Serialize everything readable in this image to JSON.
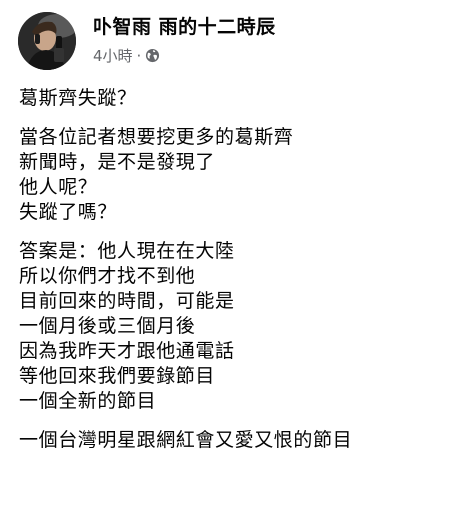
{
  "post": {
    "author": "卟智雨 雨的十二時辰",
    "timestamp": "4小時",
    "separator": "·",
    "privacy_icon": "globe-icon",
    "paragraphs": [
      [
        "葛斯齊失蹤？"
      ],
      [
        "當各位記者想要挖更多的葛斯齊",
        "新聞時，是不是發現了",
        "他人呢？",
        "失蹤了嗎？"
      ],
      [
        "答案是：他人現在在大陸",
        "所以你們才找不到他",
        "目前回來的時間，可能是",
        "一個月後或三個月後",
        "因為我昨天才跟他通電話",
        "等他回來我們要錄節目",
        "一個全新的節目"
      ],
      [
        "一個台灣明星跟網紅會又愛又恨的節目"
      ]
    ]
  },
  "colors": {
    "text": "#050505",
    "secondary": "#65676b"
  }
}
